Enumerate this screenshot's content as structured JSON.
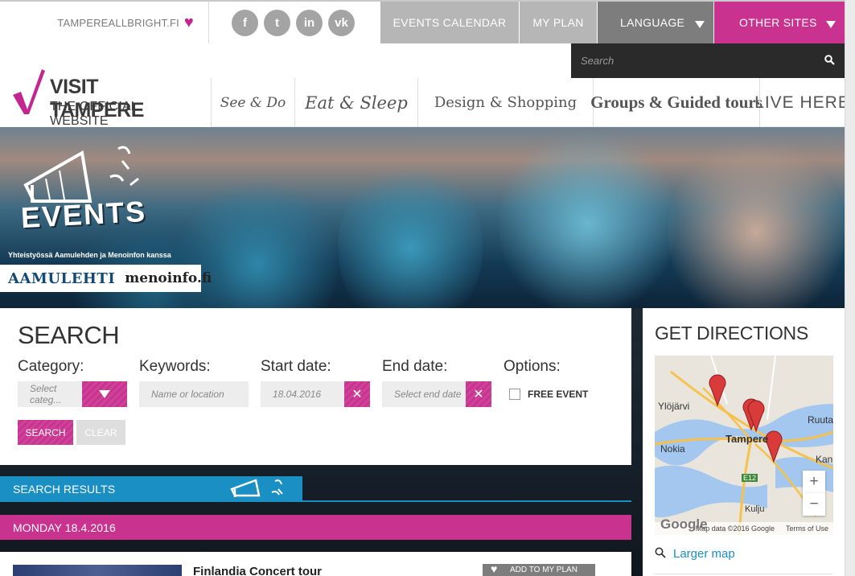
{
  "topbar": {
    "site_link": "TAMPEREALLBRIGHT.FI",
    "social": [
      {
        "icon": "facebook-icon",
        "glyph": "f"
      },
      {
        "icon": "twitter-icon",
        "glyph": "t"
      },
      {
        "icon": "linkedin-icon",
        "glyph": "in"
      },
      {
        "icon": "vk-icon",
        "glyph": "vk"
      }
    ],
    "events_calendar": "EVENTS CALENDAR",
    "my_plan": "MY PLAN",
    "language": "LANGUAGE",
    "other_sites": "OTHER SITES"
  },
  "search": {
    "placeholder": "Search"
  },
  "logo": {
    "line1": "VISIT TAMPERE",
    "line2": "THE OFFICIAL WEBSITE"
  },
  "nav": {
    "items": [
      "See & Do",
      "Eat & Sleep",
      "Design & Shopping",
      "Groups & Guided tours",
      "LIVE HERE"
    ]
  },
  "hero": {
    "events_title": "EVENTS",
    "events_sub": "Yhteistyössä Aamulehden ja Menoinfon kanssa",
    "partner1": "AAMULEHTI",
    "partner2": "menoinfo.fi"
  },
  "search_panel": {
    "title": "SEARCH",
    "category_label": "Category:",
    "category_value": "Select categ...",
    "keywords_label": "Keywords:",
    "keywords_placeholder": "Name or location",
    "start_label": "Start date:",
    "start_value": "18.04.2016",
    "end_label": "End date:",
    "end_placeholder": "Select end date",
    "options_label": "Options:",
    "free_event": "FREE EVENT",
    "search_btn": "SEARCH",
    "clear_btn": "CLEAR"
  },
  "results": {
    "tab_label": "SEARCH RESULTS",
    "day": "MONDAY 18.4.2016",
    "event_title": "Finlandia Concert tour",
    "add_to_plan": "ADD TO MY PLAN"
  },
  "directions": {
    "title": "GET DIRECTIONS",
    "map_labels": {
      "ylojarvi": "Ylöjärvi",
      "tampere": "Tampere",
      "nokia": "Nokia",
      "ruuta": "Ruuta",
      "kan": "Kan",
      "kulju": "Kulju",
      "e12": "E12"
    },
    "zoom_in": "+",
    "zoom_out": "−",
    "map_data": "Map data ©2016 Google",
    "terms": "Terms of Use",
    "google": "Google",
    "larger_map": "Larger map"
  },
  "colors": {
    "accent_pink": "#c9338f",
    "accent_blue": "#1a8fc4",
    "dark": "#2a2a2a",
    "grey_tab": "#b6b6b6"
  }
}
